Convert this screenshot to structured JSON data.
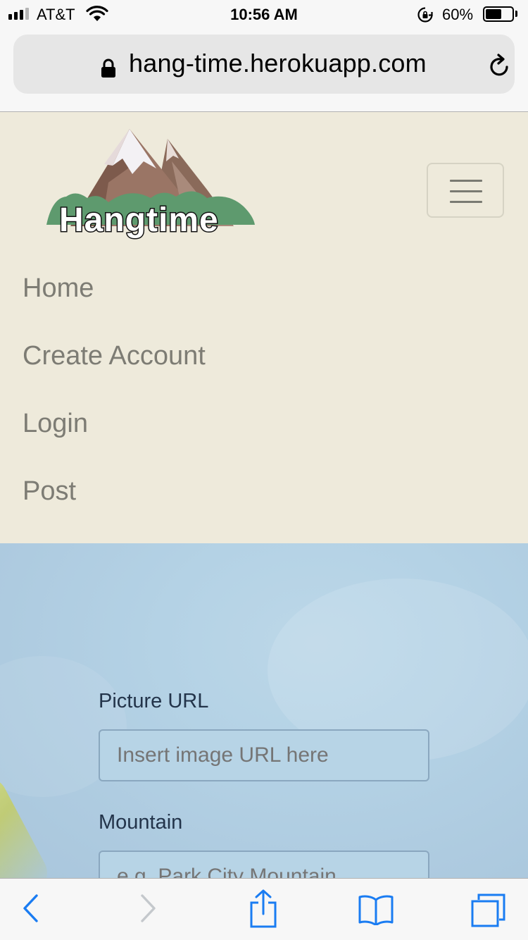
{
  "status_bar": {
    "carrier": "AT&T",
    "time": "10:56 AM",
    "battery_percent": "60%",
    "battery_level": 0.6,
    "icons": [
      "signal-icon",
      "wifi-icon",
      "rotation-lock-icon",
      "battery-icon"
    ]
  },
  "browser": {
    "url": "hang-time.herokuapp.com",
    "icons": [
      "lock-icon",
      "reload-icon"
    ]
  },
  "navbar": {
    "logo_text": "Hangtime",
    "toggler_icon": "hamburger-menu-icon",
    "items": [
      {
        "label": "Home"
      },
      {
        "label": "Create Account"
      },
      {
        "label": "Login"
      },
      {
        "label": "Post"
      }
    ]
  },
  "form": {
    "picture_url": {
      "label": "Picture URL",
      "placeholder": "Insert image URL here"
    },
    "mountain": {
      "label": "Mountain",
      "placeholder": "e.g. Park City Mountain"
    }
  },
  "toolbar": {
    "icons": [
      "back-icon",
      "forward-icon",
      "share-icon",
      "bookmarks-icon",
      "tabs-icon"
    ]
  },
  "colors": {
    "navbar_bg": "#eeeadb",
    "nav_text": "#7d7c74",
    "ios_blue": "#1a7cf2",
    "form_label": "#23344a"
  }
}
